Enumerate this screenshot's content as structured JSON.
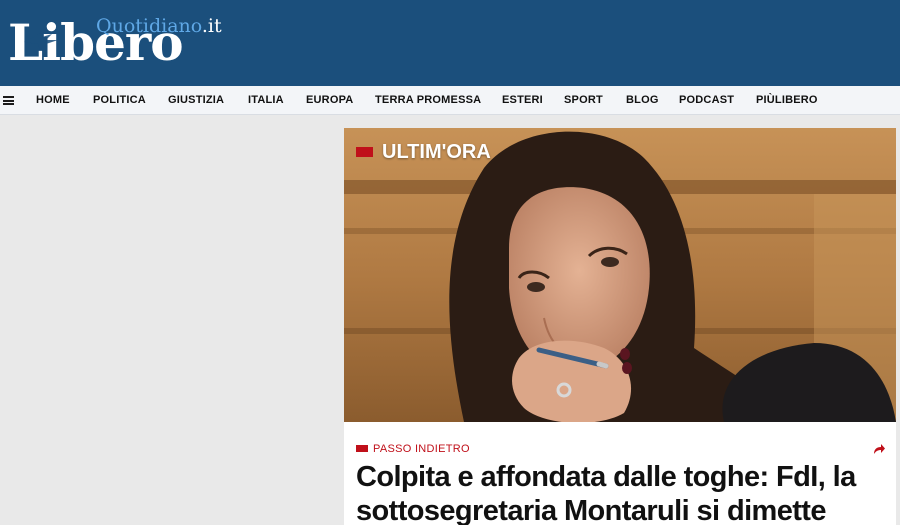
{
  "brand": {
    "logo_main": "Libero",
    "logo_sub": "Quotidiano",
    "logo_suffix": ".it",
    "header_color": "#1b4f7c",
    "accent_color": "#c0101a"
  },
  "nav": {
    "menu_icon": "hamburger-icon",
    "items": [
      "HOME",
      "POLITICA",
      "GIUSTIZIA",
      "ITALIA",
      "EUROPA",
      "TERRA PROMESSA",
      "ESTERI",
      "SPORT",
      "BLOG",
      "PODCAST",
      "PIÙLIBERO"
    ]
  },
  "article": {
    "badge": "ULTIM'ORA",
    "kicker": "PASSO INDIETRO",
    "share_icon": "share-icon",
    "headline": "Colpita e affondata dalle toghe: FdI, la sottosegretaria Montaruli si dimette"
  }
}
